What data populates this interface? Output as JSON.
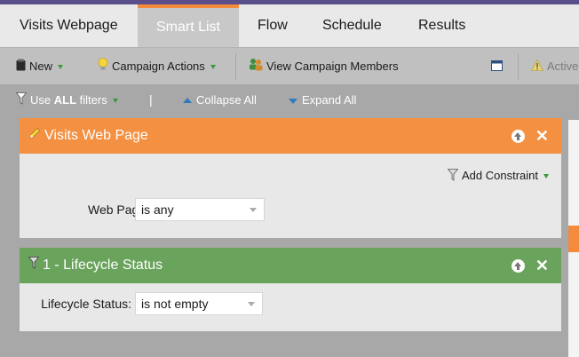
{
  "tabs": [
    {
      "label": "Visits Webpage"
    },
    {
      "label": "Smart List"
    },
    {
      "label": "Flow"
    },
    {
      "label": "Schedule"
    },
    {
      "label": "Results"
    }
  ],
  "active_tab": "Smart List",
  "toolbar": {
    "new_label": "New",
    "campaign_actions_label": "Campaign Actions",
    "view_members_label": "View Campaign Members",
    "status_label": "Active"
  },
  "filterbar": {
    "use_prefix": "Use",
    "use_all": "ALL",
    "use_suffix": "filters",
    "separator": "|",
    "collapse_label": "Collapse All",
    "expand_label": "Expand All"
  },
  "panels": [
    {
      "title": "Visits Web Page",
      "color": "#f49042",
      "add_constraint": "Add Constraint",
      "fields": [
        {
          "label": "Web Page:",
          "value": "is any"
        }
      ]
    },
    {
      "title": "1 - Lifecycle Status",
      "color": "#6aa35c",
      "fields": [
        {
          "label": "Lifecycle Status:",
          "value": "is not empty"
        }
      ]
    }
  ],
  "icons": {
    "close_glyph": "✕"
  },
  "colors": {
    "accent_orange": "#f48a3c",
    "header_purple": "#5a4f8a",
    "green": "#6aa35c"
  }
}
